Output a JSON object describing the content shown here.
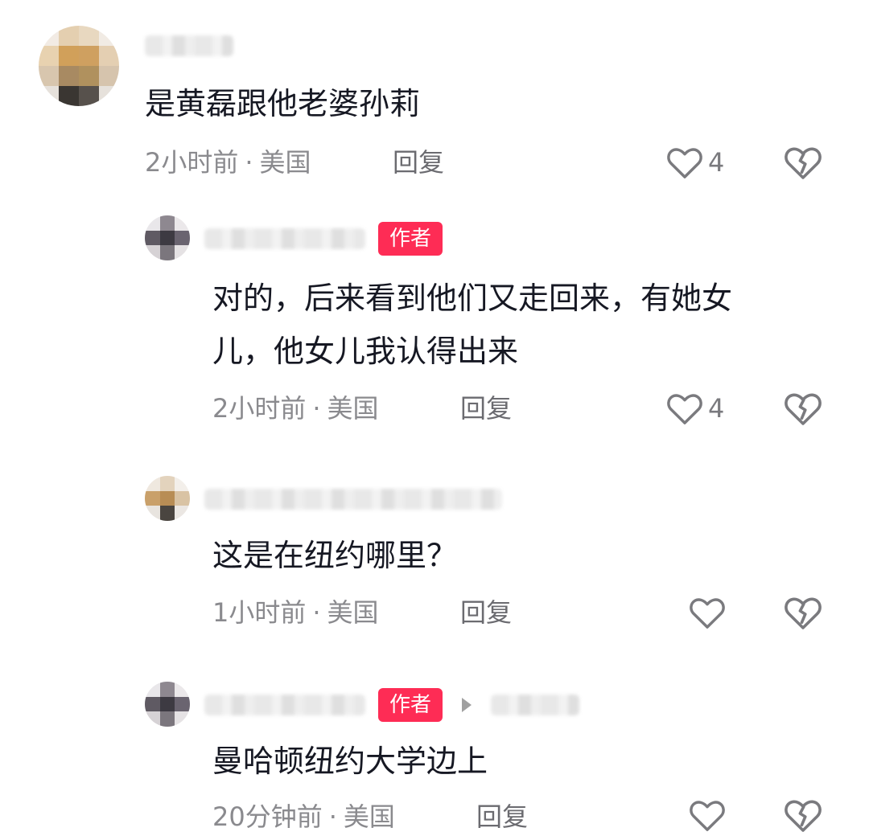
{
  "comments": [
    {
      "text": "是黄磊跟他老婆孙莉",
      "time": "2小时前",
      "location": "美国",
      "reply_label": "回复",
      "likes": "4"
    },
    {
      "badge": "作者",
      "text_line1": "对的，后来看到他们又走回来，有她女",
      "text_line2": "儿，他女儿我认得出来",
      "time": "2小时前",
      "location": "美国",
      "reply_label": "回复",
      "likes": "4"
    },
    {
      "text": "这是在纽约哪里？",
      "time": "1小时前",
      "location": "美国",
      "reply_label": "回复"
    },
    {
      "badge": "作者",
      "text": "曼哈顿纽约大学边上",
      "time": "20分钟前",
      "location": "美国",
      "reply_label": "回复"
    }
  ],
  "separator": "·",
  "icons": {
    "like": "heart-outline-icon",
    "dislike": "broken-heart-icon",
    "reply_to": "play-arrow-icon"
  },
  "colors": {
    "author_badge": "#fe2c55",
    "text": "#161823",
    "meta": "#8a8a8e",
    "icon": "#7a7a7e"
  }
}
